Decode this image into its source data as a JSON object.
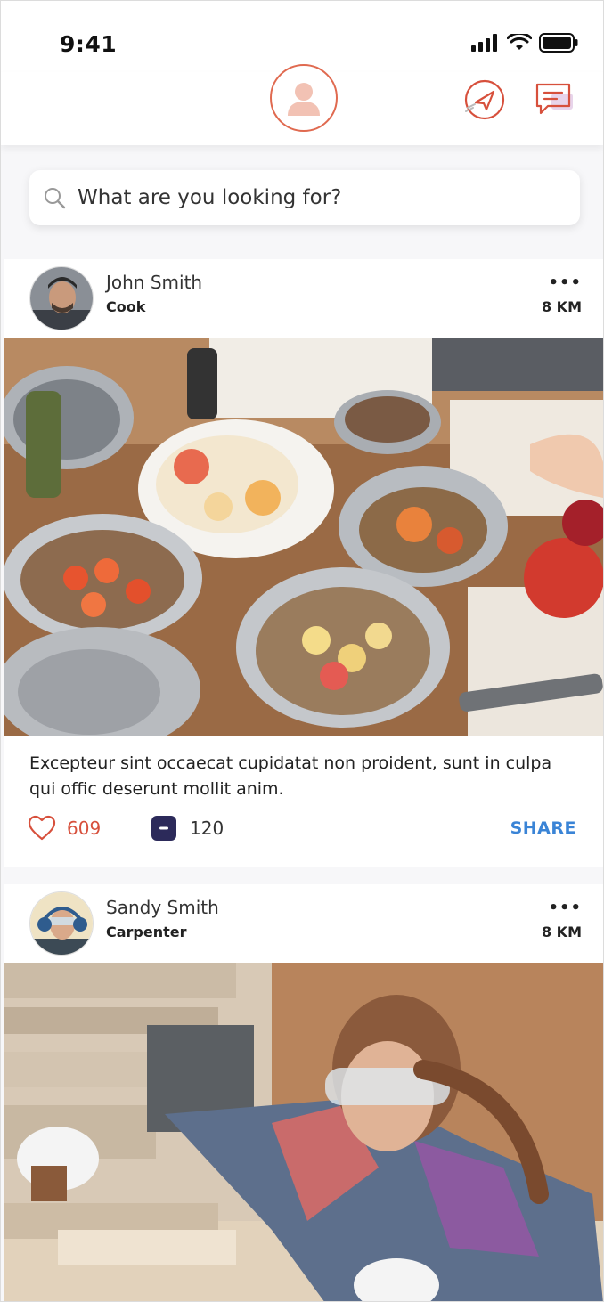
{
  "status_bar": {
    "time": "9:41"
  },
  "header": {
    "profile_icon": "user-avatar-icon",
    "location_icon": "navigation-arrow-icon",
    "messages_icon": "chat-bubble-icon",
    "accent_color": "#e06a50"
  },
  "search": {
    "placeholder": "What are you looking for?",
    "value": ""
  },
  "posts": [
    {
      "author_name": "John  Smith",
      "author_role": "Cook",
      "distance": "8 KM",
      "more_label": "•••",
      "caption": "Excepteur sint occaecat cupidatat non proident, sunt in culpa qui offic deserunt mollit anim.",
      "likes": "609",
      "comments": "120",
      "share_label": "SHARE"
    },
    {
      "author_name": "Sandy Smith",
      "author_role": "Carpenter",
      "distance": "8 KM",
      "more_label": "•••"
    }
  ],
  "colors": {
    "like": "#d7503c",
    "share": "#3a84d6",
    "comment_badge": "#2c2a5a"
  }
}
